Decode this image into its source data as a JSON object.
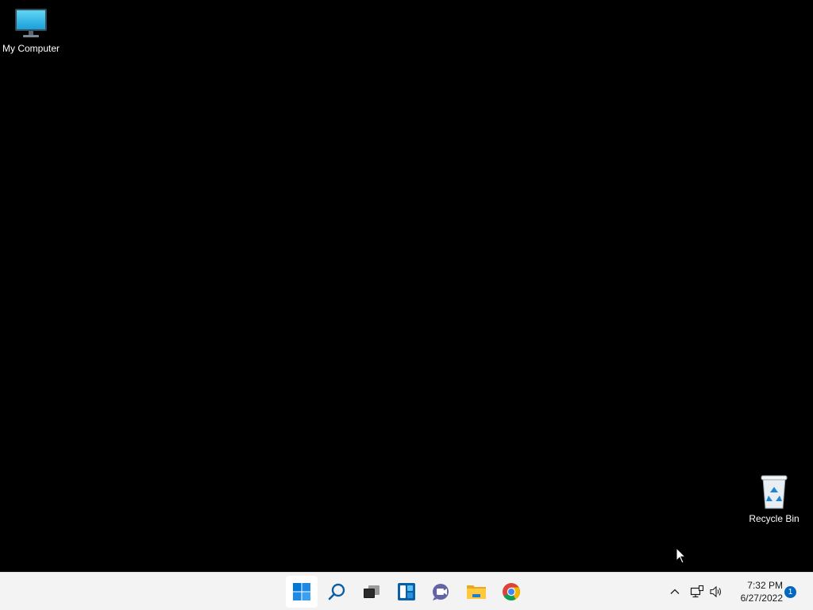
{
  "desktop": {
    "background": "#000000",
    "icons": [
      {
        "label": "My Computer",
        "icon": "monitor-icon"
      },
      {
        "label": "Recycle Bin",
        "icon": "recycle-bin-icon"
      }
    ]
  },
  "taskbar": {
    "background": "#f3f3f3",
    "apps": [
      {
        "icon": "windows-start-icon"
      },
      {
        "icon": "search-icon"
      },
      {
        "icon": "task-view-icon"
      },
      {
        "icon": "widgets-icon"
      },
      {
        "icon": "teams-chat-icon"
      },
      {
        "icon": "file-explorer-icon"
      },
      {
        "icon": "chrome-icon"
      }
    ],
    "tray": {
      "icons": [
        "chevron-up-icon",
        "network-icon",
        "volume-icon"
      ],
      "time": "7:32 PM",
      "date": "6/27/2022",
      "notification_count": "1"
    }
  },
  "colors": {
    "accent": "#0067c0",
    "start_blue": "#0078d4"
  }
}
